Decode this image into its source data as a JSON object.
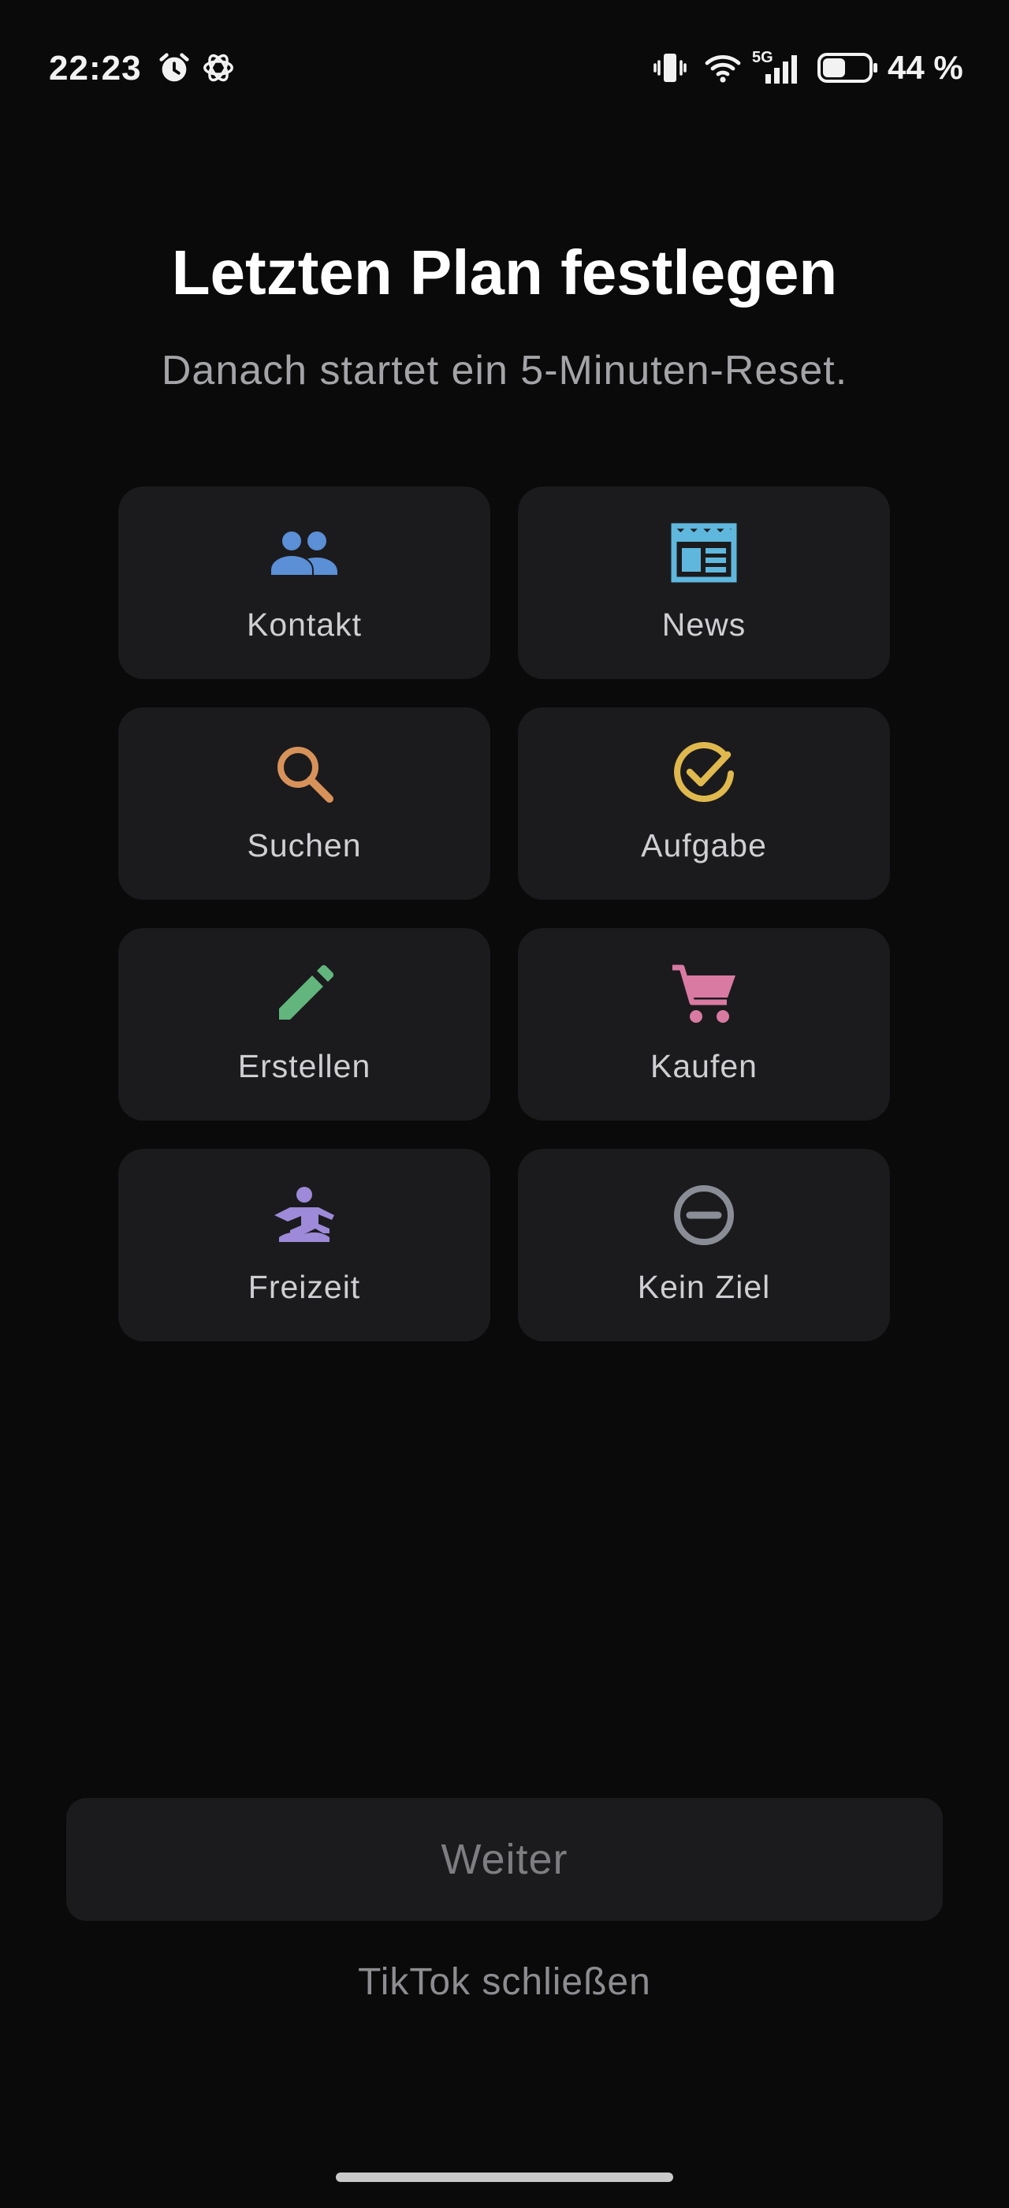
{
  "status_bar": {
    "time": "22:23",
    "battery": "44 %",
    "network": "5G",
    "icons": [
      "alarm-icon",
      "chatgpt-icon",
      "vibrate-icon",
      "wifi-icon",
      "signal-icon",
      "battery-icon"
    ]
  },
  "header": {
    "title": "Letzten Plan festlegen",
    "subtitle": "Danach startet ein 5-Minuten-Reset."
  },
  "options": [
    {
      "label": "Kontakt",
      "icon": "people-icon",
      "color": "#5b8fd6"
    },
    {
      "label": "News",
      "icon": "newspaper-icon",
      "color": "#5fb7dd"
    },
    {
      "label": "Suchen",
      "icon": "search-icon",
      "color": "#d7925a"
    },
    {
      "label": "Aufgabe",
      "icon": "check-circle-icon",
      "color": "#e0b94e"
    },
    {
      "label": "Erstellen",
      "icon": "pencil-icon",
      "color": "#62b57d"
    },
    {
      "label": "Kaufen",
      "icon": "shopping-cart-icon",
      "color": "#d97aa2"
    },
    {
      "label": "Freizeit",
      "icon": "meditation-icon",
      "color": "#9d8ad8"
    },
    {
      "label": "Kein Ziel",
      "icon": "minus-circle-icon",
      "color": "#8a8d96"
    }
  ],
  "footer": {
    "continue_label": "Weiter",
    "close_label": "TikTok schließen"
  }
}
